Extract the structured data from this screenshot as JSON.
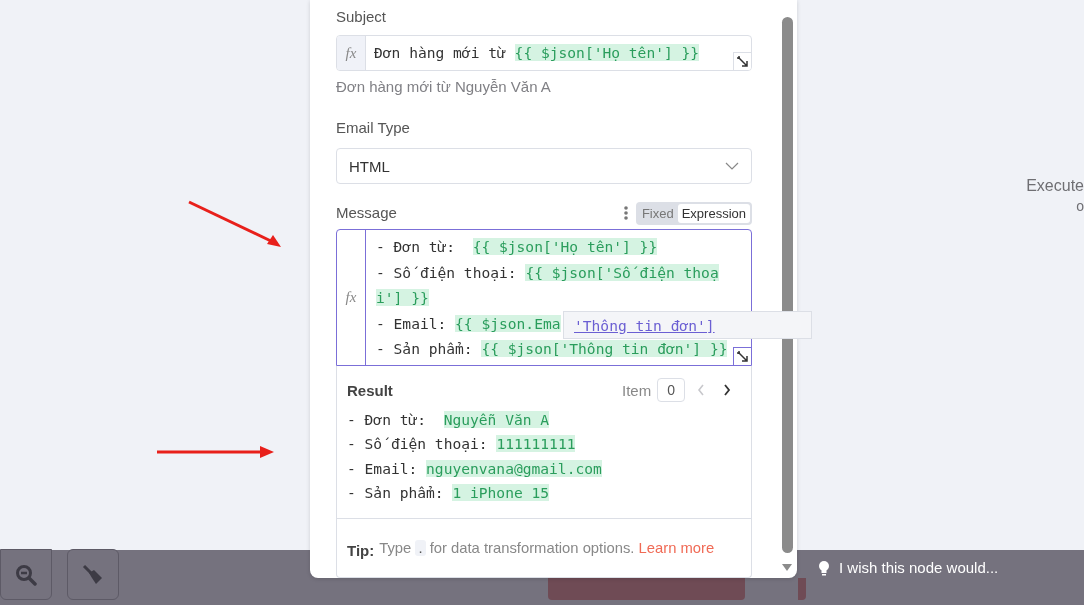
{
  "subject": {
    "label": "Subject",
    "fx": "fx",
    "segments": [
      {
        "kind": "plain",
        "text": "Đơn hàng mới từ "
      },
      {
        "kind": "expr",
        "text": "{{ $json['Họ tên'] }}"
      }
    ],
    "preview": "Đơn hàng mới từ Nguyễn Văn A"
  },
  "email_type": {
    "label": "Email Type",
    "value": "HTML"
  },
  "message": {
    "label": "Message",
    "modes": [
      {
        "label": "Fixed",
        "selected": false
      },
      {
        "label": "Expression",
        "selected": true
      }
    ],
    "fx": "fx",
    "lines": [
      [
        {
          "kind": "plain",
          "text": "- Đơn từ:  "
        },
        {
          "kind": "expr",
          "text": "{{ $json['Họ tên'] }}"
        }
      ],
      [
        {
          "kind": "plain",
          "text": "- Số điện thoại: "
        },
        {
          "kind": "expr",
          "text": "{{ $json['Số điện thoạ"
        }
      ],
      [
        {
          "kind": "expr",
          "text": "i'] }}"
        }
      ],
      [
        {
          "kind": "plain",
          "text": "- Email: "
        },
        {
          "kind": "expr",
          "text": "{{ $json.Ema"
        }
      ],
      [
        {
          "kind": "plain",
          "text": "- Sản phẩm: "
        },
        {
          "kind": "expr",
          "text": "{{ $json['Thông tin đơn'] }}"
        }
      ]
    ],
    "suggestion": "'Thông tin đơn']"
  },
  "result": {
    "title": "Result",
    "item_label": "Item",
    "item_value": "0",
    "lines": [
      [
        {
          "kind": "plain",
          "text": "- Đơn từ:  "
        },
        {
          "kind": "expr",
          "text": "Nguyễn Văn A"
        }
      ],
      [
        {
          "kind": "plain",
          "text": "- Số điện thoại: "
        },
        {
          "kind": "expr",
          "text": "111111111"
        }
      ],
      [
        {
          "kind": "plain",
          "text": "- Email: "
        },
        {
          "kind": "expr",
          "text": "nguyenvana@gmail.com"
        }
      ],
      [
        {
          "kind": "plain",
          "text": "- Sản phẩm: "
        },
        {
          "kind": "expr",
          "text": "1 iPhone 15"
        }
      ]
    ]
  },
  "tip": {
    "label": "Tip:",
    "before": "Type",
    "key": ".",
    "after": "for data transformation options.",
    "link": "Learn more"
  },
  "canvas": {
    "side_lines": [
      "Execute",
      "o"
    ],
    "feedback": "I wish this node would..."
  }
}
